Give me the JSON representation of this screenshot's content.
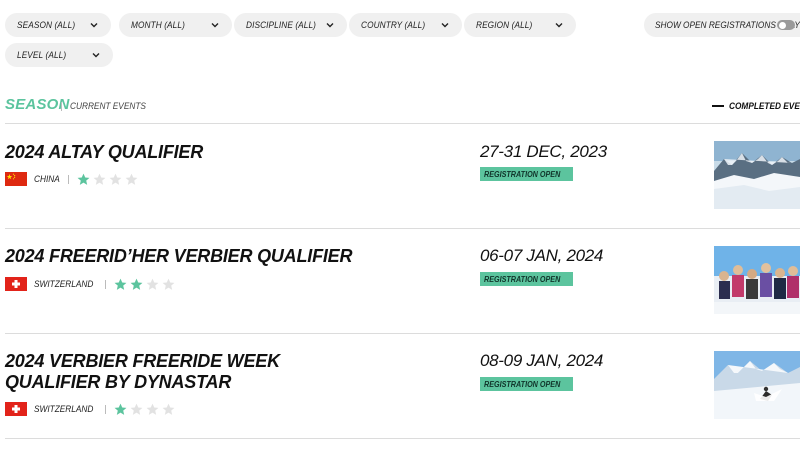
{
  "filters": [
    {
      "label": "SEASON (ALL)"
    },
    {
      "label": "MONTH (ALL)"
    },
    {
      "label": "DISCIPLINE (ALL)"
    },
    {
      "label": "COUNTRY (ALL)"
    },
    {
      "label": "REGION (ALL)"
    },
    {
      "label": "LEVEL (ALL)"
    }
  ],
  "toggle": {
    "label": "SHOW OPEN REGISTRATIONS ONLY",
    "on": false
  },
  "section": {
    "title": "SEASON",
    "subtitle": "CURRENT EVENTS",
    "completed_label": "COMPLETED EVENT"
  },
  "colors": {
    "accent": "#5cc49e",
    "star_off": "#e2e2e2",
    "pill_bg": "#f0f0f0"
  },
  "events": [
    {
      "title": "2024 ALTAY QUALIFIER",
      "country": "CHINA",
      "flag": "china-flag",
      "stars": 1,
      "stars_max": 4,
      "date": "27-31 DEC, 2023",
      "status": "REGISTRATION OPEN",
      "thumb": "snowy-mountain-range-photo"
    },
    {
      "title": "2024 FREERID’HER VERBIER QUALIFIER",
      "country": "SWITZERLAND",
      "flag": "switzerland-flag",
      "stars": 2,
      "stars_max": 4,
      "date": "06-07 JAN, 2024",
      "status": "REGISTRATION OPEN",
      "thumb": "group-of-riders-photo"
    },
    {
      "title": "2024 VERBIER FREERIDE WEEK QUALIFIER BY DYNASTAR",
      "country": "SWITZERLAND",
      "flag": "switzerland-flag",
      "stars": 1,
      "stars_max": 4,
      "date": "08-09 JAN, 2024",
      "status": "REGISTRATION OPEN",
      "thumb": "skier-in-powder-photo"
    }
  ]
}
